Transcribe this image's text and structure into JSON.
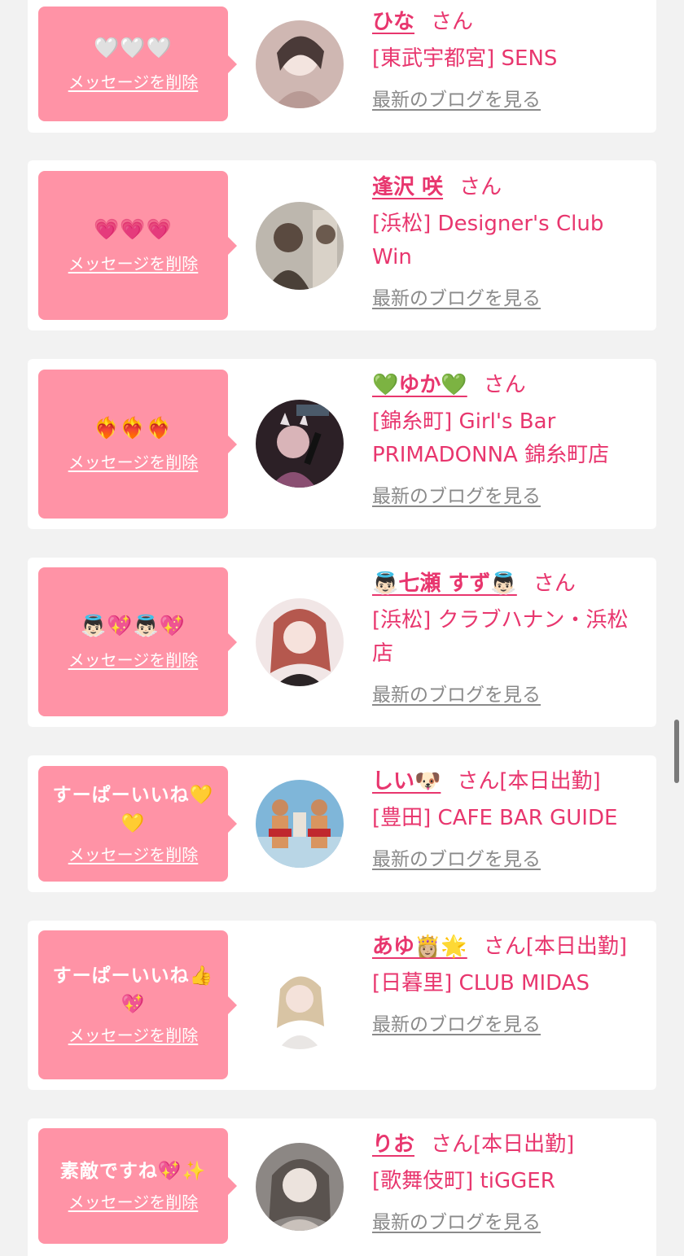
{
  "labels": {
    "delete": "メッセージを削除",
    "blog": "最新のブログを見る",
    "san": "さん"
  },
  "entries": [
    {
      "stamp": "🤍🤍🤍",
      "name": "ひな",
      "suffix": "さん",
      "shop": "[東武宇都宮] SENS",
      "avatar_palette": "#d8c3bd"
    },
    {
      "stamp": "💗💗💗",
      "name": "逢沢 咲",
      "suffix": "さん",
      "shop": "[浜松] Designer's Club Win",
      "avatar_palette": "#a8a29a"
    },
    {
      "stamp": "❤️‍🔥❤️‍🔥❤️‍🔥",
      "name": "💚ゆか💚",
      "suffix": "さん",
      "shop": "[錦糸町] Girl's Bar PRIMADONNA 錦糸町店",
      "avatar_palette": "#3a2a33"
    },
    {
      "stamp": "👼🏻💖👼🏻💖",
      "name": "👼🏻七瀬 すず👼🏻",
      "suffix": "さん",
      "shop": "[浜松] クラブハナン・浜松店",
      "avatar_palette": "#e9d6d4"
    },
    {
      "stamp": "すーぱーいいね💛💛",
      "name": "しい🐶",
      "suffix": "さん[本日出勤]",
      "shop": "[豊田] CAFE BAR GUIDE",
      "avatar_palette": "#7cb5d8"
    },
    {
      "stamp": "すーぱーいいね👍💖",
      "name": "あゆ👸🏼🌟",
      "suffix": "さん[本日出勤]",
      "shop": "[日暮里] CLUB MIDAS",
      "avatar_palette": "#f4efec"
    },
    {
      "stamp": "素敵ですね💖✨",
      "name": "りお",
      "suffix": "さん[本日出勤]",
      "shop": "[歌舞伎町] tiGGER",
      "avatar_palette": "#8a8582"
    }
  ],
  "colors": {
    "accent": "#e8366e",
    "bubble": "#ff93a6",
    "link_gray": "#8a8a8a",
    "background": "#f2f2f2"
  }
}
